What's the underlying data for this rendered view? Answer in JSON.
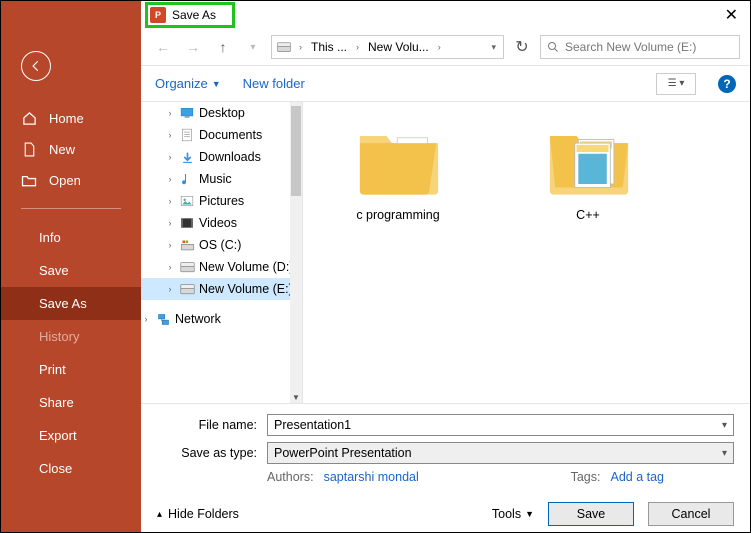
{
  "sidebar": {
    "nav": [
      {
        "label": "Home"
      },
      {
        "label": "New"
      },
      {
        "label": "Open"
      }
    ],
    "sub": [
      {
        "key": "info",
        "label": "Info"
      },
      {
        "key": "save",
        "label": "Save"
      },
      {
        "key": "saveas",
        "label": "Save As",
        "active": true
      },
      {
        "key": "history",
        "label": "History",
        "dim": true
      },
      {
        "key": "print",
        "label": "Print"
      },
      {
        "key": "share",
        "label": "Share"
      },
      {
        "key": "export",
        "label": "Export"
      },
      {
        "key": "close",
        "label": "Close"
      }
    ]
  },
  "dialog": {
    "title": "Save As",
    "breadcrumb": {
      "seg1": "This ...",
      "seg2": "New Volu..."
    },
    "search_placeholder": "Search New Volume (E:)",
    "toolbar": {
      "organize": "Organize",
      "newfolder": "New folder"
    },
    "tree": [
      {
        "label": "Desktop",
        "icon": "desktop"
      },
      {
        "label": "Documents",
        "icon": "doc"
      },
      {
        "label": "Downloads",
        "icon": "down"
      },
      {
        "label": "Music",
        "icon": "music"
      },
      {
        "label": "Pictures",
        "icon": "pic"
      },
      {
        "label": "Videos",
        "icon": "vid"
      },
      {
        "label": "OS (C:)",
        "icon": "drive-os"
      },
      {
        "label": "New Volume (D:)",
        "icon": "drive"
      },
      {
        "label": "New Volume (E:)",
        "icon": "drive",
        "selected": true
      },
      {
        "label": "Network",
        "icon": "network",
        "toplevel": true
      }
    ],
    "content_folders": [
      {
        "label": "c programming",
        "variant": "plain"
      },
      {
        "label": "C++",
        "variant": "notes"
      }
    ],
    "filename_label": "File name:",
    "filename_value": "Presentation1",
    "filetype_label": "Save as type:",
    "filetype_value": "PowerPoint Presentation",
    "authors_label": "Authors:",
    "authors_value": "saptarshi mondal",
    "tags_label": "Tags:",
    "tags_value": "Add a tag",
    "hide_folders": "Hide Folders",
    "tools_label": "Tools",
    "save_label": "Save",
    "cancel_label": "Cancel"
  }
}
